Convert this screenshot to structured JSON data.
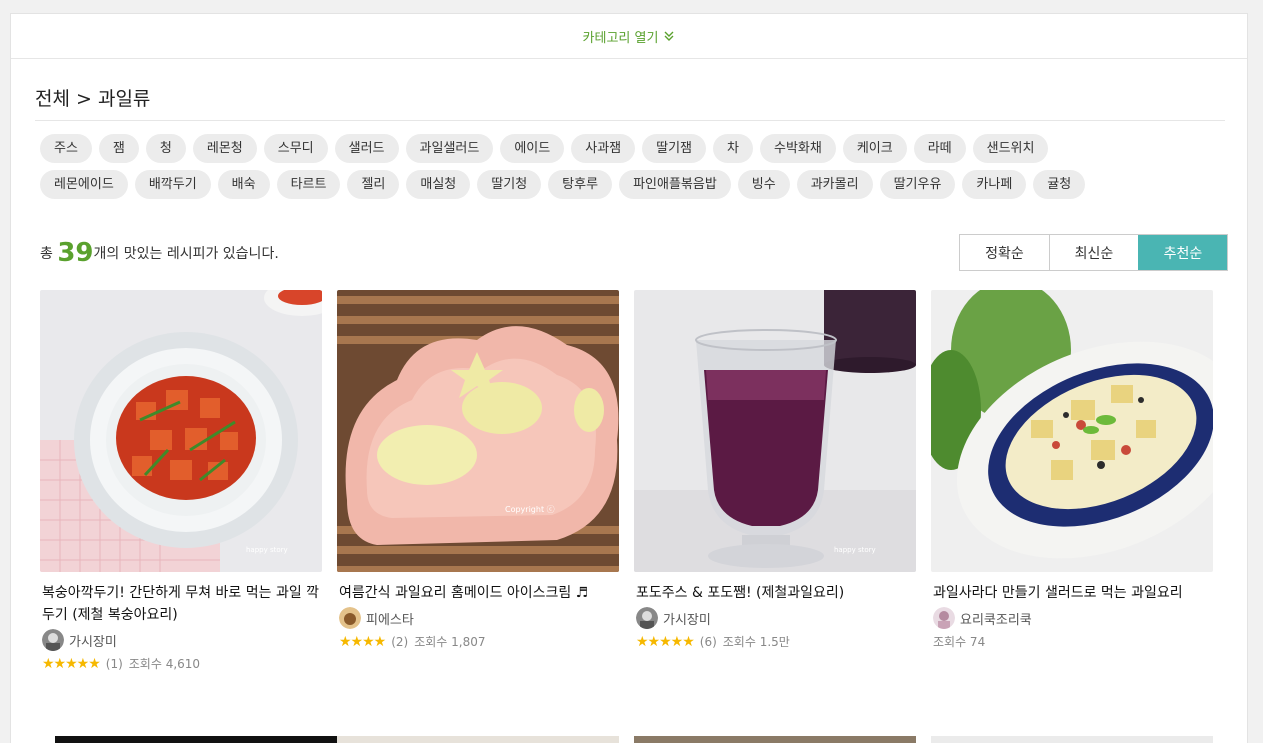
{
  "category_toggle": {
    "label": "카테고리 열기"
  },
  "breadcrumb": "전체 > 과일류",
  "tags": {
    "row1": [
      "주스",
      "잼",
      "청",
      "레몬청",
      "스무디",
      "샐러드",
      "과일샐러드",
      "에이드",
      "사과잼",
      "딸기잼",
      "차",
      "수박화채",
      "케이크",
      "라떼",
      "샌드위치"
    ],
    "row2": [
      "레몬에이드",
      "배깍두기",
      "배숙",
      "타르트",
      "젤리",
      "매실청",
      "딸기청",
      "탕후루",
      "파인애플볶음밥",
      "빙수",
      "과카몰리",
      "딸기우유",
      "카나페",
      "귤청"
    ]
  },
  "result": {
    "prefix": "총 ",
    "count": "39",
    "suffix": "개의 맛있는 레시피가 있습니다."
  },
  "sort": {
    "accuracy": "정확순",
    "latest": "최신순",
    "recommended": "추천순"
  },
  "recipes": [
    {
      "title": "복숭아깍두기! 간단하게 무쳐 바로 먹는 과일 깍두기 (제철 복숭아요리)",
      "author": "가시장미",
      "stars": "★★★★★",
      "reviews": "(1)",
      "views": "조회수 4,610"
    },
    {
      "title": "여름간식 과일요리 홈메이드 아이스크림 ♬",
      "author": "피에스타",
      "stars": "★★★★",
      "reviews": "(2)",
      "views": "조회수 1,807"
    },
    {
      "title": "포도주스 & 포도쨈! (제철과일요리)",
      "author": "가시장미",
      "stars": "★★★★★",
      "reviews": "(6)",
      "views": "조회수 1.5만"
    },
    {
      "title": "과일사라다 만들기 샐러드로 먹는 과일요리",
      "author": "요리쿡조리쿡",
      "stars": "",
      "reviews": "",
      "views": "조회수 74"
    }
  ],
  "colors": {
    "accent_green": "#5aa12e",
    "sort_active": "#4ab5b3",
    "star": "#f6b800"
  }
}
